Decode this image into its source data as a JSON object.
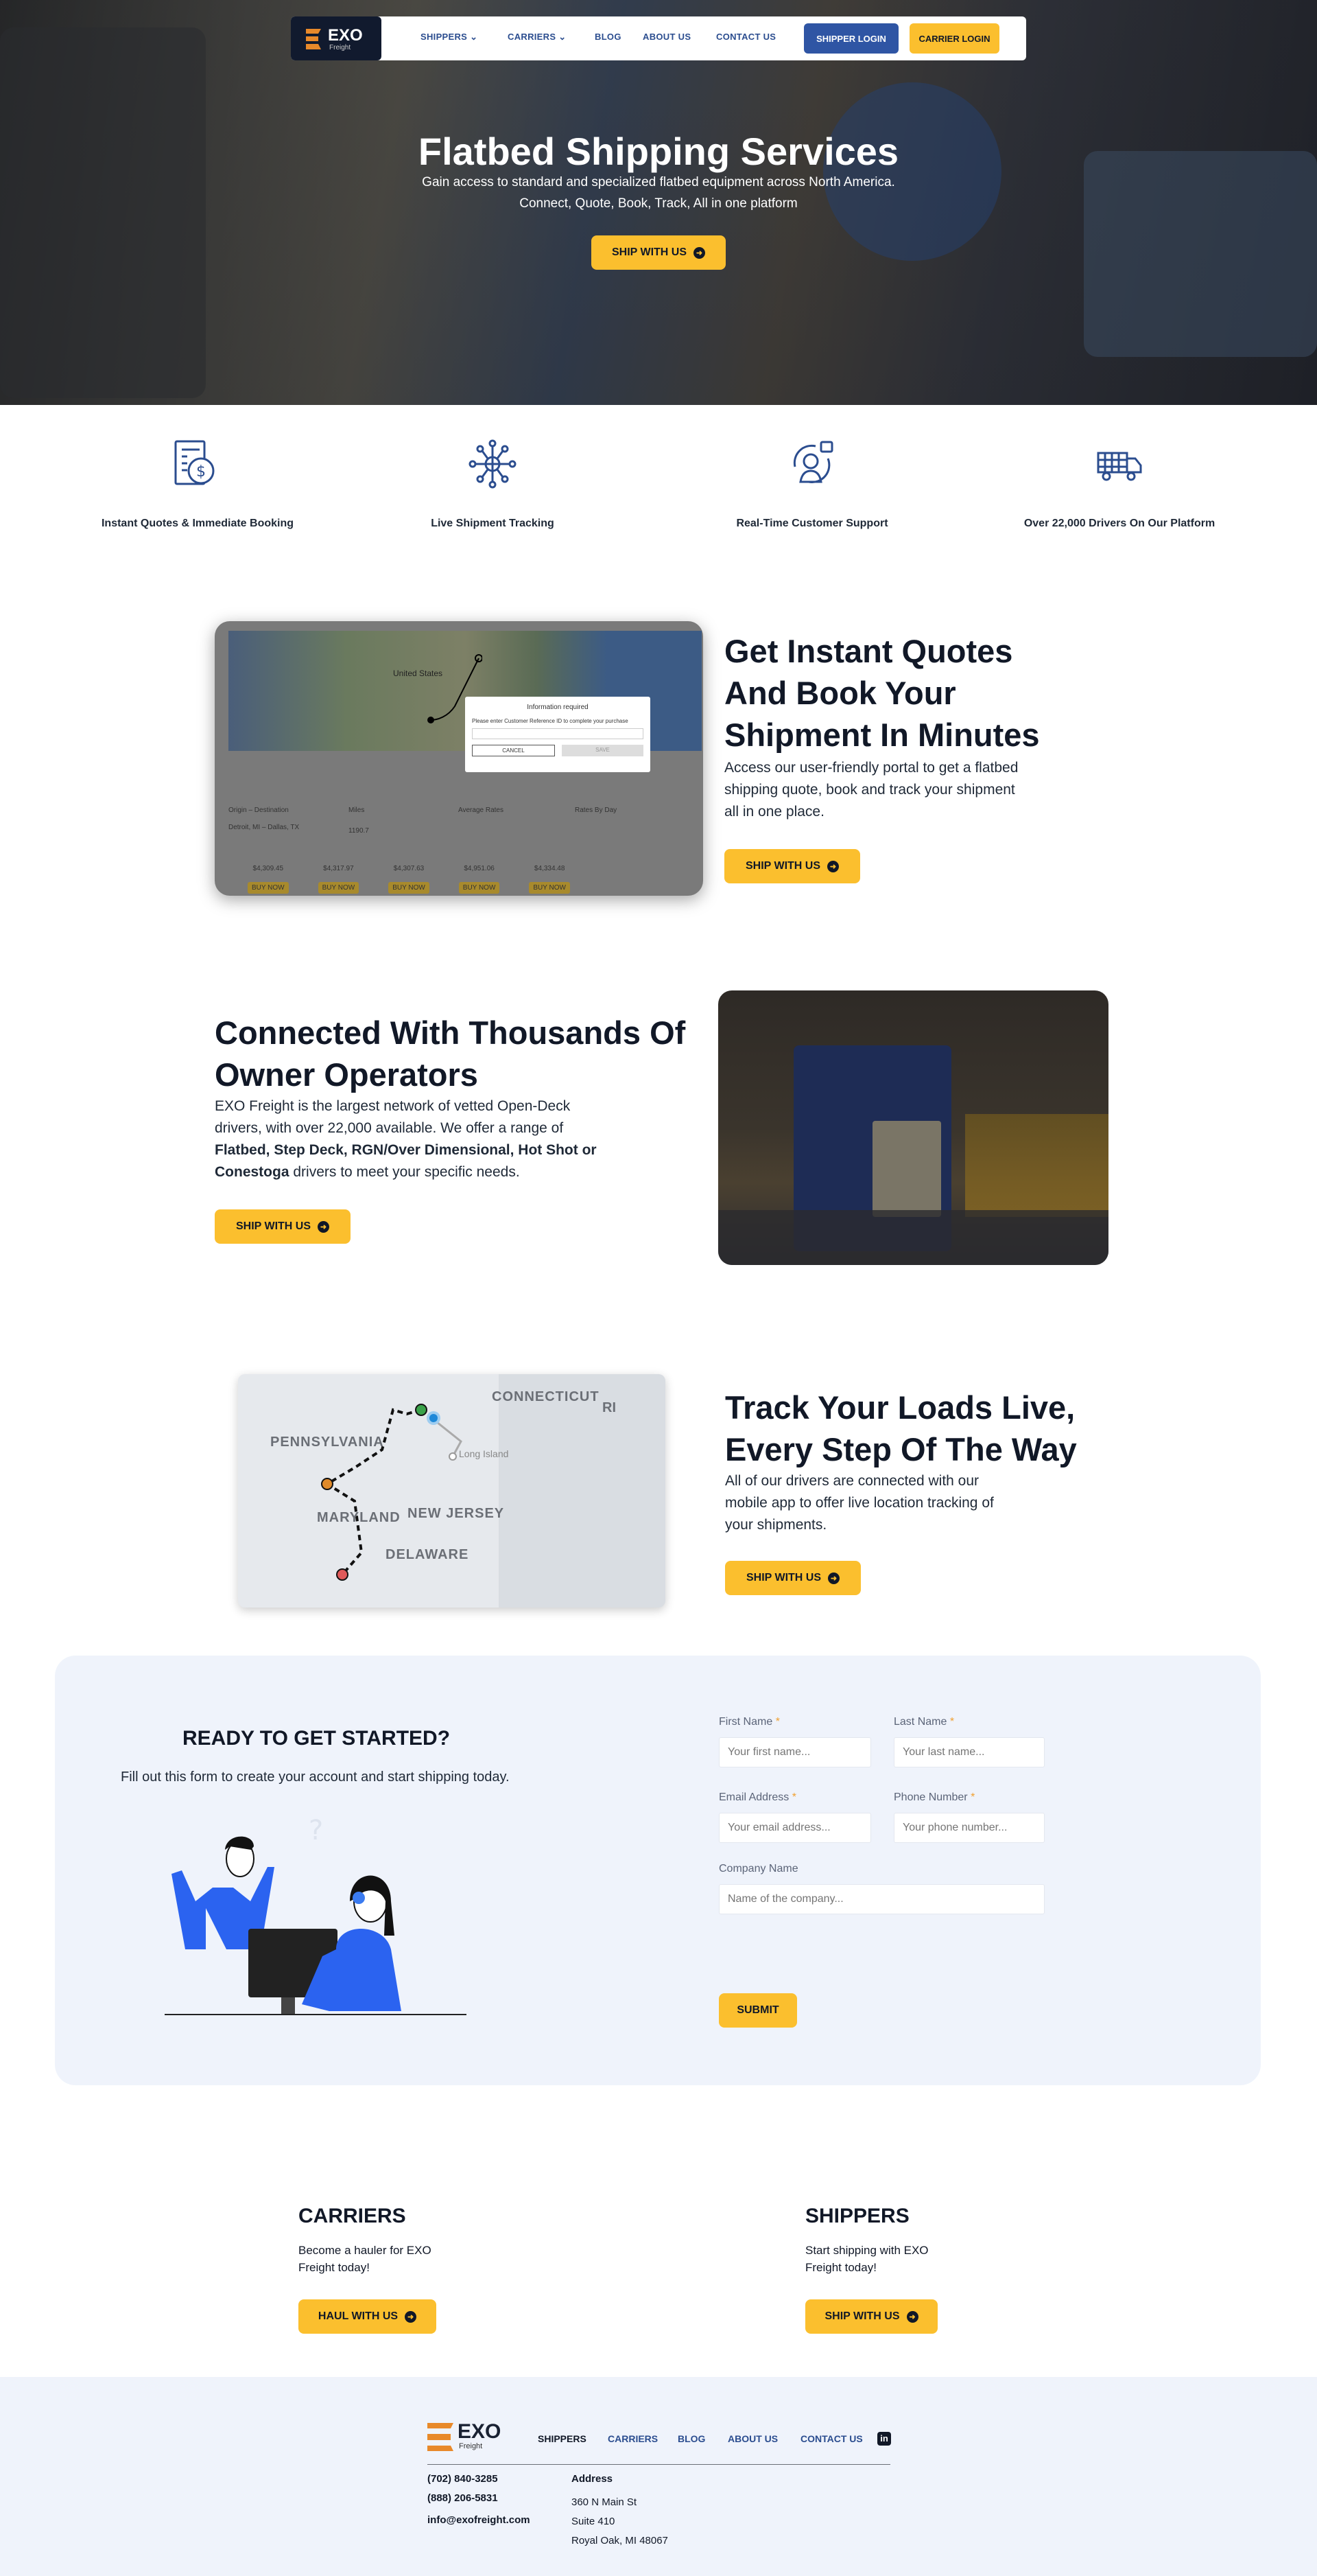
{
  "nav": {
    "logo": "EXO",
    "logo_sub": "Freight",
    "items": [
      {
        "label": "SHIPPERS",
        "dropdown": true
      },
      {
        "label": "CARRIERS",
        "dropdown": true
      },
      {
        "label": "BLOG"
      },
      {
        "label": "ABOUT US"
      },
      {
        "label": "CONTACT US"
      }
    ],
    "shipper_login": "SHIPPER LOGIN",
    "carrier_login": "CARRIER LOGIN"
  },
  "hero": {
    "title": "Flatbed Shipping Services",
    "subtitle1": "Gain access to standard and specialized flatbed equipment across North America.",
    "subtitle2": "Connect, Quote, Book, Track, All in one platform",
    "cta": "SHIP WITH US"
  },
  "features": [
    {
      "icon": "invoice-dollar-icon",
      "label": "Instant Quotes & Immediate Booking"
    },
    {
      "icon": "network-globe-icon",
      "label": "Live Shipment Tracking"
    },
    {
      "icon": "customer-support-icon",
      "label": "Real-Time Customer Support"
    },
    {
      "icon": "trucks-icon",
      "label": "Over 22,000 Drivers On Our Platform"
    }
  ],
  "quotes": {
    "title": "Get Instant Quotes And Book Your Shipment In Minutes",
    "text": "Access our user-friendly portal to get a flatbed shipping quote, book and track your shipment all in one place.",
    "cta": "SHIP WITH US",
    "portal": {
      "dialog_title": "Information required",
      "dialog_text": "Please enter Customer Reference ID to complete your purchase",
      "cancel": "CANCEL",
      "save": "SAVE",
      "map_label": "United States",
      "headers": [
        "Origin – Destination",
        "Miles",
        "Average Rates",
        "Rates By Day"
      ],
      "route": "Detroit, MI – Dallas, TX",
      "miles": "1190.7",
      "rates": [
        "$4,309.45",
        "$4,317.97",
        "$4,307.63",
        "$4,951.06",
        "$4,334.48"
      ],
      "buy": "BUY NOW"
    }
  },
  "operators": {
    "title": "Connected With Thousands Of Owner Operators",
    "text_pre": "EXO Freight is the largest network of vetted Open-Deck drivers, with over 22,000 available. We offer a range of ",
    "text_bold": "Flatbed, Step Deck, RGN/Over Dimensional, Hot Shot or Conestoga",
    "text_post": " drivers to meet your specific needs.",
    "cta": "SHIP WITH US"
  },
  "tracking": {
    "title": "Track Your Loads Live, Every Step Of The Way",
    "text": "All of our drivers are connected with our mobile app to offer live location tracking of your shipments.",
    "cta": "SHIP WITH US",
    "map_labels": [
      "CONNECTICUT",
      "RI",
      "PENNSYLVANIA",
      "Long Island",
      "MARYLAND",
      "NEW JERSEY",
      "DELAWARE"
    ]
  },
  "signup": {
    "title": "READY TO GET STARTED?",
    "text": "Fill out this form to create your account and start shipping today.",
    "fields": [
      {
        "label": "First Name",
        "required": true,
        "placeholder": "Your first name..."
      },
      {
        "label": "Last Name",
        "required": true,
        "placeholder": "Your last name..."
      },
      {
        "label": "Email Address",
        "required": true,
        "placeholder": "Your email address..."
      },
      {
        "label": "Phone Number",
        "required": true,
        "placeholder": "Your phone number..."
      },
      {
        "label": "Company Name",
        "required": false,
        "placeholder": "Name of the company..."
      }
    ],
    "required_mark": "*",
    "submit": "SUBMIT"
  },
  "cta_cards": [
    {
      "title": "CARRIERS",
      "text": "Become a hauler for EXO Freight today!",
      "button": "HAUL WITH US"
    },
    {
      "title": "SHIPPERS",
      "text": "Start shipping with EXO Freight today!",
      "button": "SHIP WITH US"
    }
  ],
  "footer": {
    "links": [
      "SHIPPERS",
      "CARRIERS",
      "BLOG",
      "ABOUT US",
      "CONTACT US"
    ],
    "phone1": "(702) 840-3285",
    "phone2": "(888) 206-5831",
    "email": "info@exofreight.com",
    "address_title": "Address",
    "address": [
      "360 N Main St",
      "Suite 410",
      "Royal Oak, MI 48067"
    ]
  },
  "colors": {
    "accent": "#fbbf2e",
    "navy": "#111827",
    "brand_blue": "#2b4d8f",
    "orange": "#e8892a",
    "panel": "#eff3fb"
  }
}
